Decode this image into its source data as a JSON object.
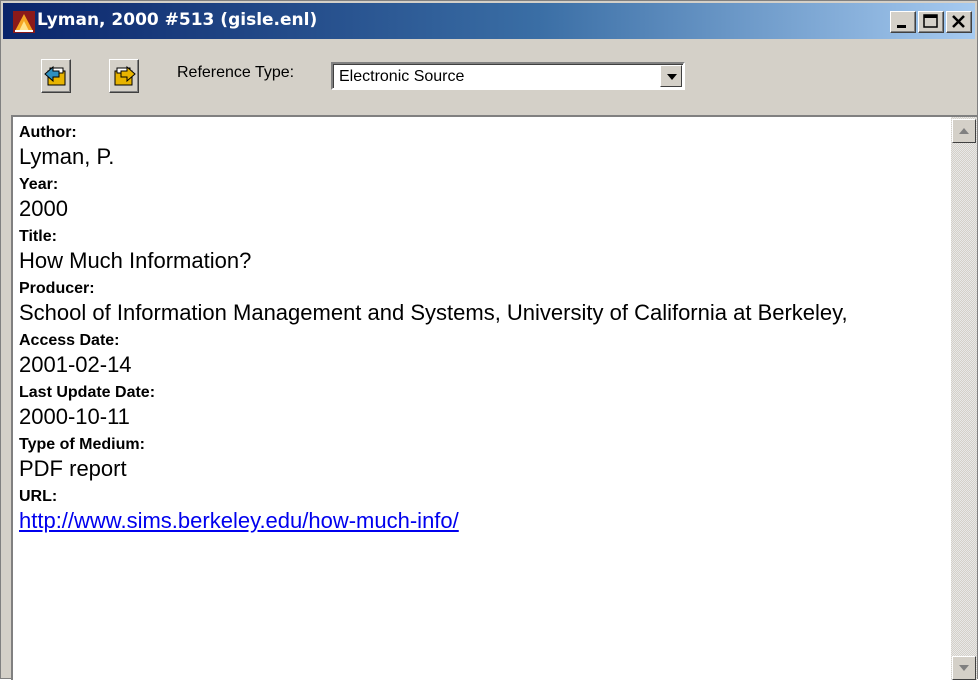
{
  "window": {
    "title": "Lyman, 2000 #513  (gisle.enl)",
    "app_icon": "endnote-app-icon",
    "controls": [
      "minimize-icon",
      "maximize-icon",
      "close-icon"
    ]
  },
  "toolbar": {
    "prev_button_icon": "previous-reference-icon",
    "next_button_icon": "next-reference-icon",
    "reference_type_label": "Reference Type:",
    "reference_type_value": "Electronic Source"
  },
  "fields": [
    {
      "label": "Author:",
      "value": "Lyman, P."
    },
    {
      "label": "Year:",
      "value": "2000"
    },
    {
      "label": "Title:",
      "value": "How Much Information?"
    },
    {
      "label": "Producer:",
      "value": "School of Information Management and Systems, University of California at Berkeley,"
    },
    {
      "label": "Access Date:",
      "value": "2001-02-14"
    },
    {
      "label": "Last Update Date:",
      "value": "2000-10-11"
    },
    {
      "label": "Type of Medium:",
      "value": "PDF report"
    },
    {
      "label": "URL:",
      "value": "http://www.sims.berkeley.edu/how-much-info/"
    }
  ],
  "colors": {
    "titlebar_start": "#0a246a",
    "titlebar_end": "#a6caf0",
    "chrome": "#d4d0c8",
    "link": "#0000ee"
  }
}
